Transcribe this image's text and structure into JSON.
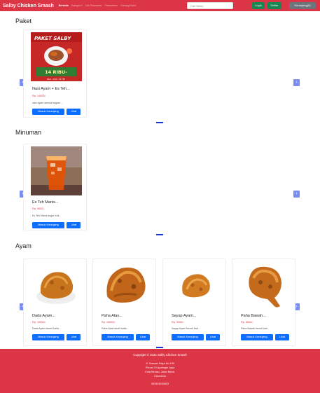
{
  "navbar": {
    "brand": "Salby Chicken Smash",
    "links": [
      "Beranda",
      "Kategori ▾",
      "Cek Pesanamu",
      "Pesananmu",
      "Hubungi Kami"
    ],
    "search_placeholder": "Cari Menu",
    "login_label": "Login",
    "daftar_label": "Daftar",
    "cart_label": "Keranjang(0)"
  },
  "sections": [
    {
      "title": "Paket",
      "products": [
        {
          "name": "Nasi Ayam + Es Teh...",
          "price": "Rp. 14000/-",
          "desc": "nasi ayam semua bagian ...",
          "image": "paket-salby-poster",
          "poster_title": "PAKET SALBY",
          "poster_price": "14 RIBU-",
          "poster_sub": "NASI · AYAM · ES TEH"
        }
      ]
    },
    {
      "title": "Minuman",
      "products": [
        {
          "name": "Es Teh Manis...",
          "price": "Rp. 4000/-",
          "desc": "Es Teh Manis segar tubi...",
          "image": "iced-tea-glass"
        }
      ]
    },
    {
      "title": "Ayam",
      "products": [
        {
          "name": "Dada Ayam...",
          "price": "Rp. 10000/-",
          "desc": "Dada Ayam favorit kalia...",
          "image": "fried-chicken-breast"
        },
        {
          "name": "Paha Atas...",
          "price": "Rp. 10000/-",
          "desc": "Paha Atas favorit kalia...",
          "image": "fried-chicken-thigh"
        },
        {
          "name": "Sayap Ayam...",
          "price": "Rp. 9000/-",
          "desc": "Sayap Ayam favorit kali...",
          "image": "fried-chicken-wing"
        },
        {
          "name": "Paha Bawah...",
          "price": "Rp. 8000/-",
          "desc": "Paha Bawah favorit kali...",
          "image": "fried-chicken-drumstick"
        }
      ]
    }
  ],
  "buttons": {
    "add_to_cart": "Masuk Keranjang",
    "view": "Lihat"
  },
  "footer": {
    "copyright": "Copyright © 2022 Salby Chicken Smash",
    "address_lines": [
      "Jl. Kasuari Raya No.165",
      "Perum I Kayuringin Jaya",
      "Kota Bekasi, Jawa Barat,",
      "Indonesia"
    ],
    "phone": "081904560803"
  },
  "colors": {
    "brand_red": "#dc3545",
    "button_blue": "#0d6efd",
    "green": "#198754",
    "price_red": "#dc3545"
  }
}
